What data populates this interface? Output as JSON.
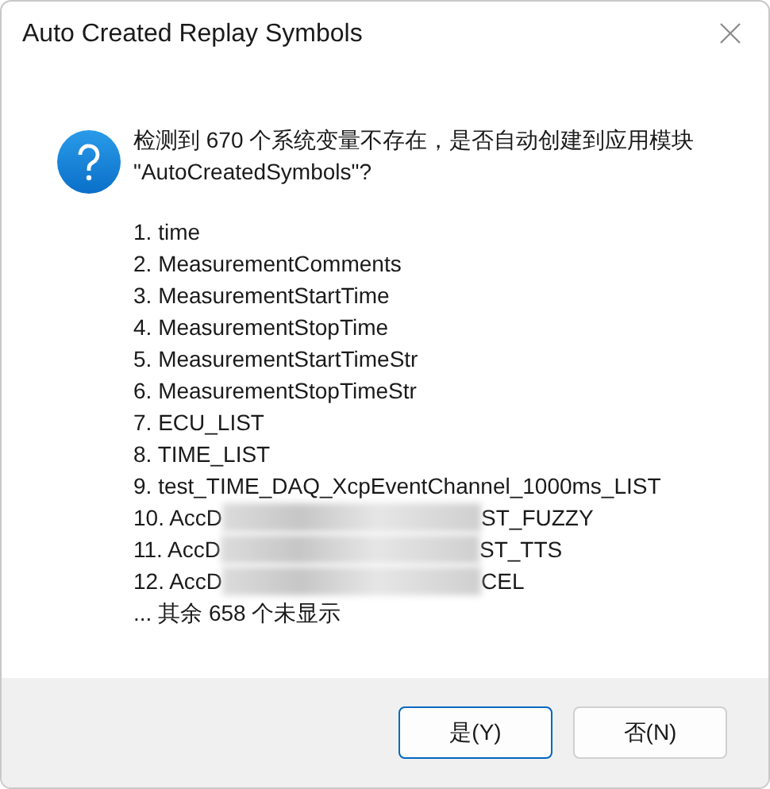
{
  "window": {
    "title": "Auto Created Replay Symbols"
  },
  "message": {
    "line_1": "检测到 670 个系统变量不存在，是否自动创建到应用模块",
    "line_2": "\"AutoCreatedSymbols\"?"
  },
  "items": [
    {
      "kind": "plain",
      "text": "1. time"
    },
    {
      "kind": "plain",
      "text": "2. MeasurementComments"
    },
    {
      "kind": "plain",
      "text": "3. MeasurementStartTime"
    },
    {
      "kind": "plain",
      "text": "4. MeasurementStopTime"
    },
    {
      "kind": "plain",
      "text": "5. MeasurementStartTimeStr"
    },
    {
      "kind": "plain",
      "text": "6. MeasurementStopTimeStr"
    },
    {
      "kind": "plain",
      "text": "7. ECU_LIST"
    },
    {
      "kind": "plain",
      "text": "8. TIME_LIST"
    },
    {
      "kind": "plain",
      "text": "9. test_TIME_DAQ_XcpEventChannel_1000ms_LIST"
    },
    {
      "kind": "redacted",
      "text": "10. AccD",
      "after": "ST_FUZZY"
    },
    {
      "kind": "redacted",
      "text": "11. AccD",
      "after": "ST_TTS"
    },
    {
      "kind": "redacted",
      "text": "12. AccD",
      "after": "CEL"
    }
  ],
  "remainder": "... 其余 658 个未显示",
  "buttons": [
    {
      "label": "是(Y)",
      "selected": true
    },
    {
      "label": "否(N)",
      "selected": false
    }
  ]
}
